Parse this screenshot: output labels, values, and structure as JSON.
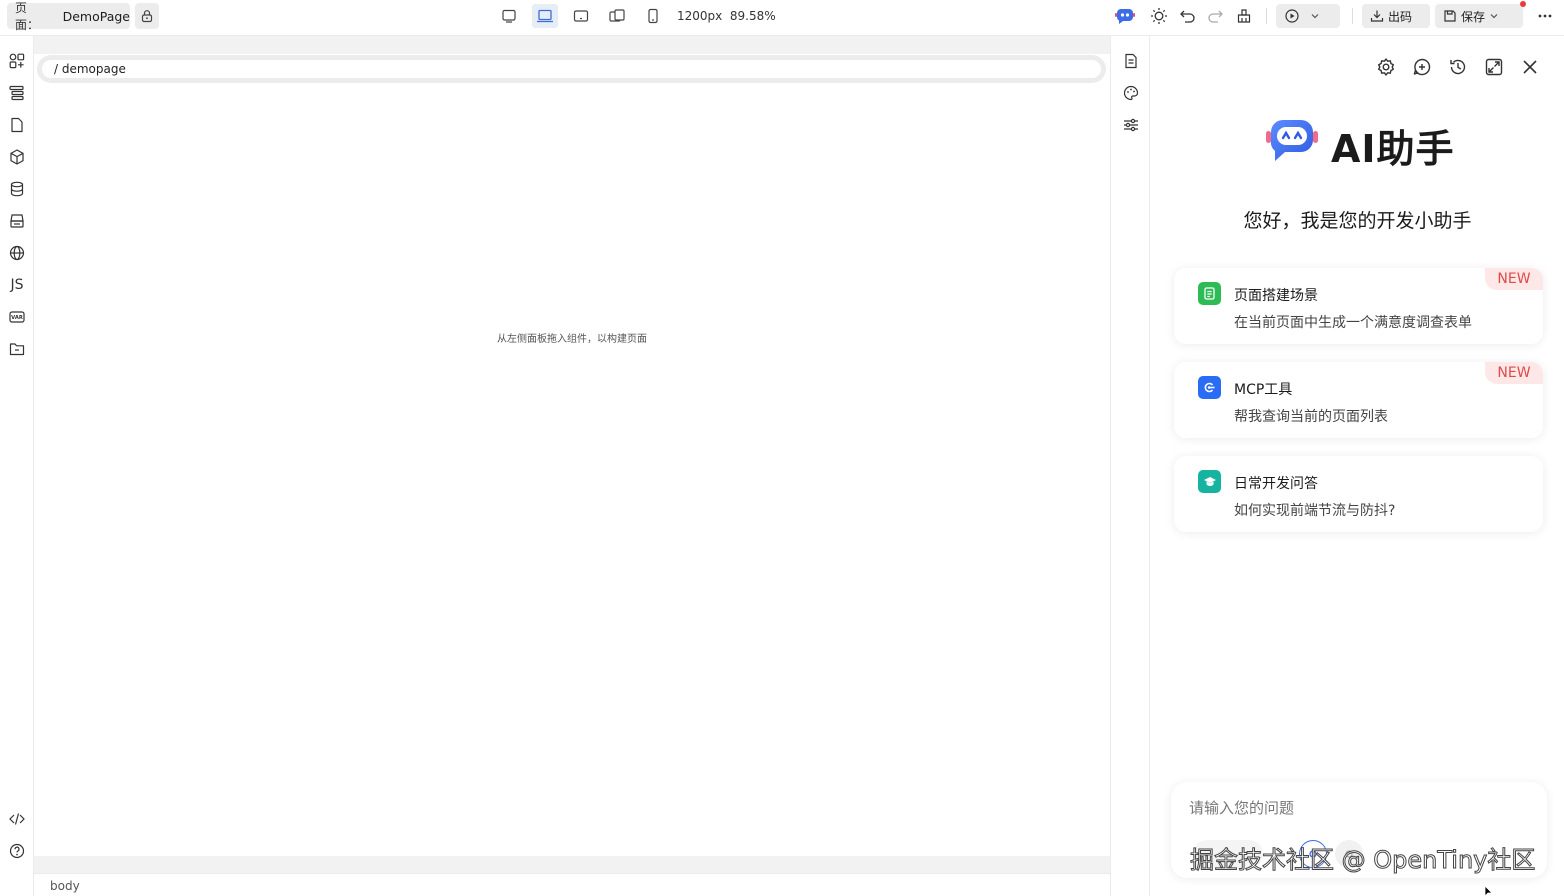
{
  "topbar": {
    "page_label": "页面：",
    "page_name": "DemoPage",
    "canvas_size": "1200px",
    "zoom": "89.58%",
    "export_label": "出码",
    "save_label": "保存",
    "icons": [
      "lock-icon",
      "desktop-icon",
      "laptop-icon",
      "tablet-landscape-icon",
      "tablet-icon",
      "mobile-icon",
      "ai-robot-icon",
      "theme-sun-icon",
      "undo-icon",
      "redo-icon",
      "clean-icon",
      "preview-play-icon",
      "download-icon",
      "save-icon",
      "more-icon"
    ]
  },
  "left_sidebar": {
    "icons": [
      "components-icon",
      "outline-tree-icon",
      "page-icon",
      "block-icon",
      "datasource-icon",
      "bridge-icon",
      "i18n-globe-icon",
      "js-icon",
      "variable-icon",
      "folder-icon",
      "code-icon",
      "help-icon"
    ],
    "js_label": "JS"
  },
  "canvas": {
    "breadcrumb": "/ demopage",
    "hint": "从左侧面板拖入组件，以构建页面",
    "status_path": "body"
  },
  "right_sidebar": {
    "icons": [
      "properties-icon",
      "style-palette-icon",
      "advanced-settings-icon"
    ]
  },
  "ai_panel": {
    "title": "AI助手",
    "greeting": "您好，我是您的开发小助手",
    "cards": [
      {
        "title": "页面搭建场景",
        "desc": "在当前页面中生成一个满意度调查表单",
        "badge": "NEW",
        "color": "#2dbb55"
      },
      {
        "title": "MCP工具",
        "desc": "帮我查询当前的页面列表",
        "badge": "NEW",
        "color": "#2a6df4"
      },
      {
        "title": "日常开发问答",
        "desc": "如何实现前端节流与防抖?",
        "badge": "",
        "color": "#16b3a0"
      }
    ],
    "input_placeholder": "请输入您的问题",
    "header_icons": [
      "settings-icon",
      "new-chat-icon",
      "history-icon",
      "fullscreen-icon",
      "close-icon"
    ]
  },
  "watermark": "掘金技术社区 @ OpenTiny社区"
}
